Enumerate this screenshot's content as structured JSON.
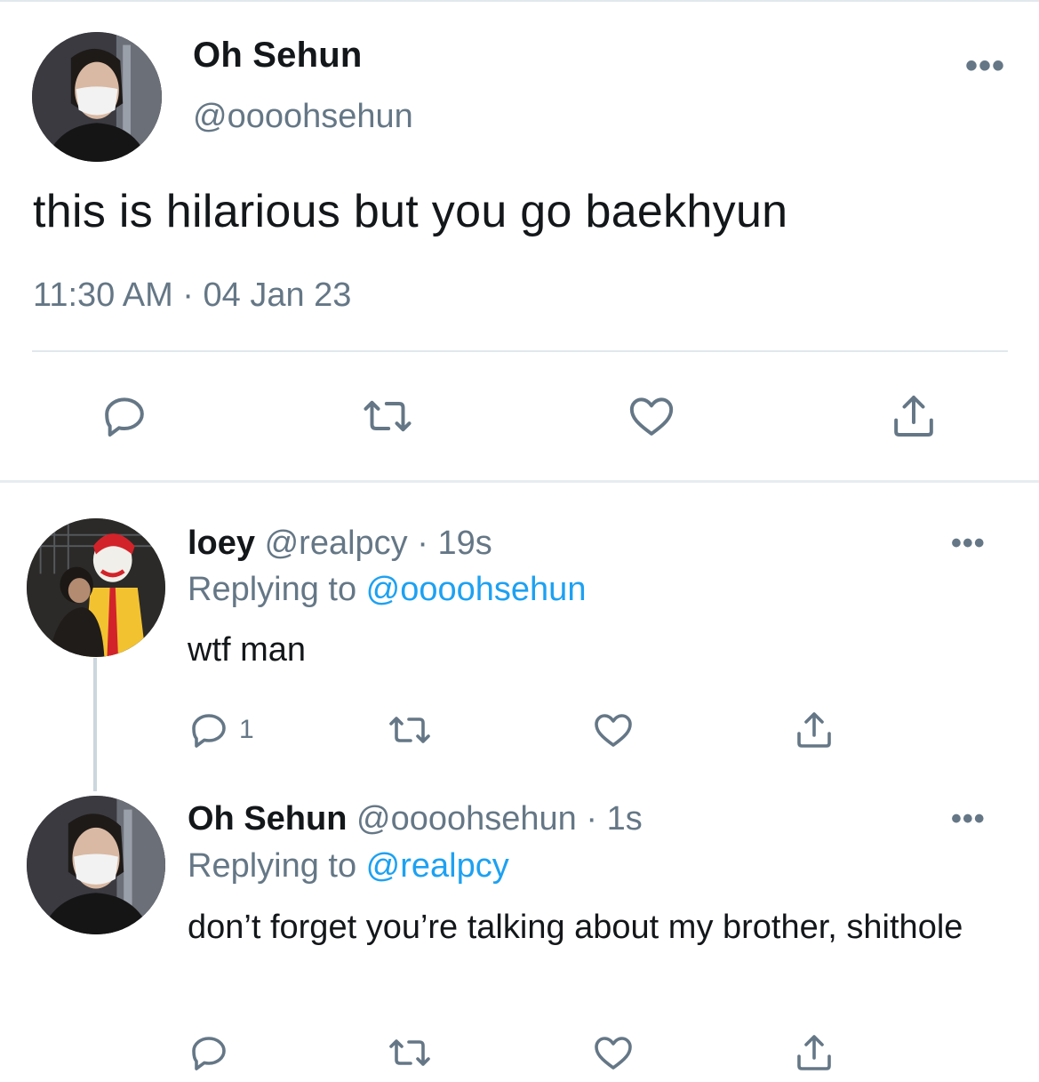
{
  "main_tweet": {
    "author_name": "Oh Sehun",
    "author_handle": "@oooohsehun",
    "text": "this is hilarious but you go baekhyun",
    "timestamp": "11:30 AM · 04 Jan 23",
    "more_glyph": "•••",
    "actions": [
      {
        "name": "reply",
        "icon": "reply-icon"
      },
      {
        "name": "retweet",
        "icon": "retweet-icon"
      },
      {
        "name": "like",
        "icon": "like-icon"
      },
      {
        "name": "share",
        "icon": "share-icon"
      }
    ]
  },
  "replies": [
    {
      "author_name": "loey",
      "meta": "@realpcy · 19s",
      "replying_prefix": "Replying to ",
      "replying_to": "@oooohsehun",
      "text": "wtf man",
      "reply_count": "1",
      "more_glyph": "•••"
    },
    {
      "author_name": "Oh Sehun",
      "meta": "@oooohsehun · 1s",
      "replying_prefix": "Replying to ",
      "replying_to": "@realpcy",
      "text": "don’t forget you’re talking about my brother, shithole",
      "reply_count": "",
      "more_glyph": "•••"
    }
  ],
  "colors": {
    "text": "#14171a",
    "secondary": "#657786",
    "link": "#1da1f2",
    "divider": "#e1e8ed"
  }
}
